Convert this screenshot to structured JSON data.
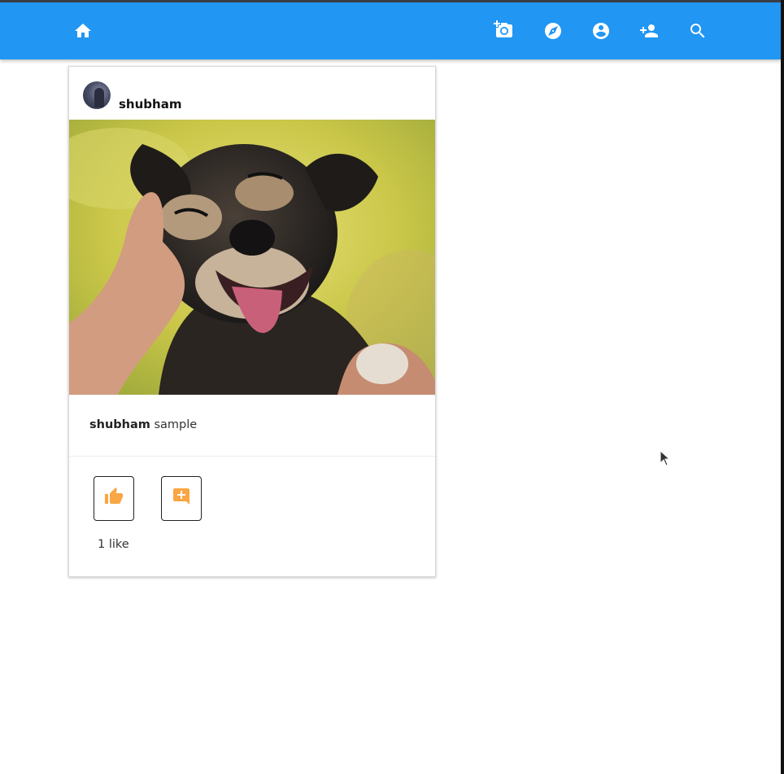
{
  "nav": {
    "icons": [
      "home-icon",
      "add-photo-icon",
      "explore-icon",
      "account-icon",
      "person-add-icon",
      "search-icon"
    ]
  },
  "post": {
    "username": "shubham",
    "caption_user": "shubham",
    "caption_text": "sample",
    "likes_text": "1 like",
    "image_subject": "happy dog being petted"
  },
  "actions": {
    "like_icon": "thumb-up-icon",
    "comment_icon": "add-comment-icon"
  },
  "colors": {
    "navbar": "#2196f3",
    "action_icon": "#f9a644"
  }
}
